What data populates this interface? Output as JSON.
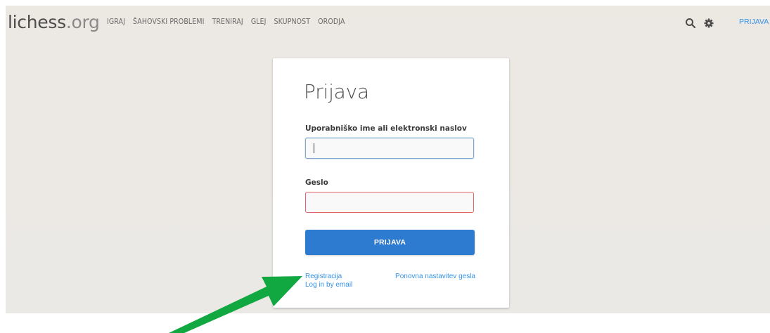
{
  "header": {
    "logo_main": "lichess",
    "logo_suffix": ".org",
    "nav": [
      "IGRAJ",
      "ŠAHOVSKI PROBLEMI",
      "TRENIRAJ",
      "GLEJ",
      "SKUPNOST",
      "ORODJA"
    ],
    "signin_label": "PRIJAVA",
    "icons": [
      "search-icon",
      "gear-icon"
    ]
  },
  "login": {
    "title": "Prijava",
    "username_label": "Uporabniško ime ali elektronski naslov",
    "username_value": "",
    "password_label": "Geslo",
    "password_value": "",
    "submit_label": "PRIJAVA",
    "register_link": "Registracija",
    "email_login_link": "Log in by email",
    "reset_password_link": "Ponovna nastavitev gesla"
  },
  "colors": {
    "accent": "#2d7ad1",
    "link": "#3692e7",
    "error_border": "#e46565",
    "annotation_arrow": "#12a841"
  }
}
